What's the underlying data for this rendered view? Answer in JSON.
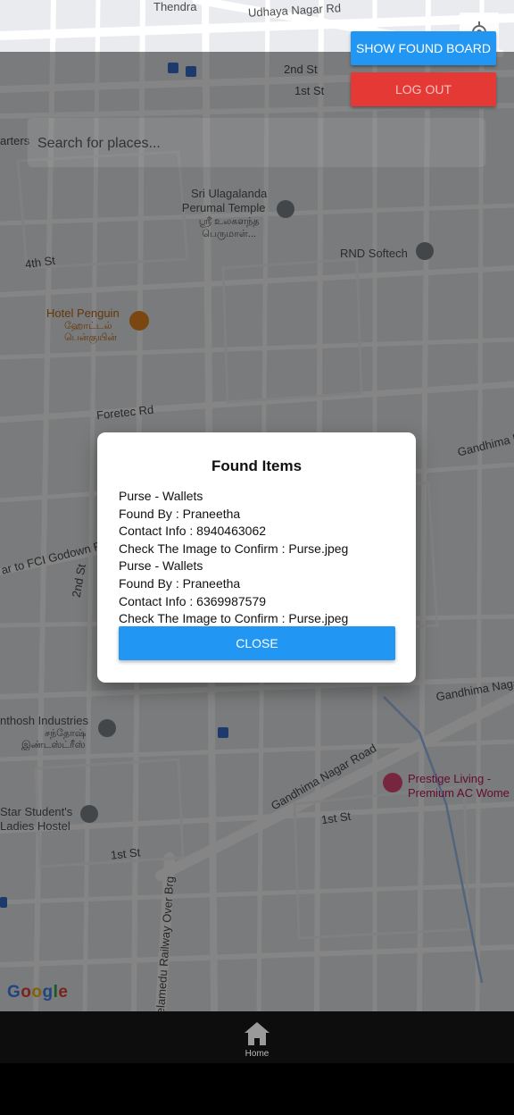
{
  "header": {
    "show_found_board_label": "SHOW FOUND BOARD",
    "logout_label": "LOG OUT"
  },
  "search": {
    "placeholder": "Search for places..."
  },
  "map": {
    "streets": {
      "udhaya": "Udhaya Nagar Rd",
      "thendral": "Thendra",
      "second_st_top": "2nd St",
      "first_st_top": "1st St",
      "fourth_st": "4th St",
      "foretec": "Foretec Rd",
      "fci": "ar to FCI Godown Rd",
      "second_st_mid": "2nd St",
      "gandhima_top": "Gandhima N",
      "gandhima_mid": "Gandhima Nagar",
      "gandhima_road": "Gandhima Nagar Road",
      "first_st_right": "1st St",
      "first_st_bottom": "1st St",
      "railway": "elamedu Railway Over Brg",
      "arters": "arters"
    },
    "places": {
      "temple_en_1": "Sri Ulagalanda",
      "temple_en_2": "Perumal Temple",
      "temple_ta_1": "ஸ்ரீ உலகளந்த",
      "temple_ta_2": "பெருமாள்...",
      "rnd": "RND Softech",
      "hotel_en": "Hotel Penguin",
      "hotel_ta_1": "ஹோட்டல்",
      "hotel_ta_2": "பென்குயின்",
      "santhosh_en": "nthosh Industries",
      "santhosh_ta": "சந்தோஷ்",
      "santhosh_ta_2": "இண்டஸ்ட்ரீஸ்",
      "prestige_1": "Prestige Living -",
      "prestige_2": "Premium AC Wome",
      "star_1": "Star Student's",
      "star_2": "Ladies Hostel"
    },
    "attribution": "Google"
  },
  "dialog": {
    "title": "Found Items",
    "lines": [
      "Purse - Wallets",
      "Found By : Praneetha",
      "Contact Info : 8940463062",
      "Check The Image to Confirm : Purse.jpeg",
      "Purse - Wallets",
      "Found By : Praneetha",
      "Contact Info : 6369987579",
      "Check The Image to Confirm : Purse.jpeg"
    ],
    "close_label": "CLOSE"
  },
  "tabs": [
    {
      "label": "Home",
      "icon": "home-icon"
    }
  ],
  "colors": {
    "primary": "#2196f3",
    "danger": "#e53935",
    "map_bg": "#e9ebee"
  }
}
